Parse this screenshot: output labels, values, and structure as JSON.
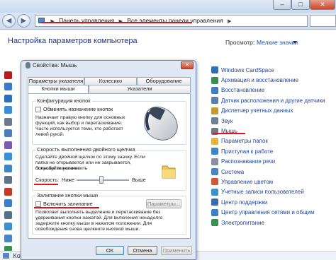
{
  "window": {
    "buttons": {
      "minimize": "–",
      "maximize": "□",
      "close": "✕"
    }
  },
  "address": {
    "back_icon": "back-arrow-icon",
    "forward_icon": "forward-arrow-icon",
    "root_icon": "control-panel-icon",
    "segments": [
      "Панель управления",
      "Все элементы панели управления"
    ]
  },
  "page": {
    "title": "Настройка параметров компьютера",
    "view_label": "Просмотр:",
    "view_value": "Мелкие значки"
  },
  "left_items": [
    {
      "icon": "flash-icon",
      "color": "#b71c1c"
    },
    {
      "icon": "windows-flag-icon",
      "color": "#3a78c9"
    },
    {
      "icon": "notification-icon",
      "color": "#2f6fb6"
    },
    {
      "icon": "toolbar-icon",
      "color": "#3c8bd6"
    },
    {
      "icon": "mouse-icon",
      "color": "#6b7b8c"
    },
    {
      "icon": "program-icon",
      "color": "#4a7fbf"
    },
    {
      "icon": "defender-icon",
      "color": "#7a5bb0"
    },
    {
      "icon": "book-icon",
      "color": "#3f8fd6"
    },
    {
      "icon": "clock-icon",
      "color": "#3a86c7"
    },
    {
      "icon": "keyboard-icon",
      "color": "#5e738a"
    },
    {
      "icon": "shield-icon",
      "color": "#c5392d"
    },
    {
      "icon": "network-icon",
      "color": "#3f7ec4"
    },
    {
      "icon": "printer-icon",
      "color": "#58708a"
    },
    {
      "icon": "user-icon",
      "color": "#3a91d0"
    },
    {
      "icon": "monitor-icon",
      "color": "#4a84c2"
    },
    {
      "icon": "globe-icon",
      "color": "#3a8e52"
    }
  ],
  "right_items": [
    {
      "label": "Windows CardSpace",
      "icon": "cardspace-icon",
      "color": "#2f6fb6"
    },
    {
      "label": "Архивация и восстановление",
      "icon": "backup-icon",
      "color": "#3a8e52"
    },
    {
      "label": "Восстановление",
      "icon": "recovery-icon",
      "color": "#3f7ec4"
    },
    {
      "label": "Датчик расположения и другие датчики",
      "icon": "sensor-icon",
      "color": "#5a7fa8"
    },
    {
      "label": "Диспетчер учетных данных",
      "icon": "credential-icon",
      "color": "#c89a2c"
    },
    {
      "label": "Звук",
      "icon": "speaker-icon",
      "color": "#6e7f92"
    },
    {
      "label": "Мышь",
      "icon": "mouse-icon",
      "color": "#6b7b8c"
    },
    {
      "label": "Параметры папок",
      "icon": "folder-icon",
      "color": "#e3b43c"
    },
    {
      "label": "Приступая к работе",
      "icon": "start-icon",
      "color": "#3a86c7"
    },
    {
      "label": "Распознавание речи",
      "icon": "microphone-icon",
      "color": "#8b8f97"
    },
    {
      "label": "Система",
      "icon": "computer-icon",
      "color": "#4a84c2"
    },
    {
      "label": "Управление цветом",
      "icon": "color-icon",
      "color": "#d0583a"
    },
    {
      "label": "Учетные записи пользователей",
      "icon": "users-icon",
      "color": "#3a91d0"
    },
    {
      "label": "Центр поддержки",
      "icon": "flag-icon",
      "color": "#3b68b5"
    },
    {
      "label": "Центр управления сетями и общим",
      "icon": "network-icon",
      "color": "#3f7ec4"
    },
    {
      "label": "Электропитание",
      "icon": "power-icon",
      "color": "#3a8e52"
    }
  ],
  "status": {
    "text": "Ко"
  },
  "dialog": {
    "title": "Свойства: Мышь",
    "close": "✕",
    "tabs_back": [
      "Параметры указателя",
      "Колесико",
      "Оборудование"
    ],
    "tabs_front": [
      "Кнопки мыши",
      "Указатели"
    ],
    "buttons_group": {
      "label": "Конфигурация кнопок",
      "checkbox": "Обменять назначение кнопок",
      "lines": [
        "Назначает правую кнопку для основных функций, как выбор и перетаскивание. Часто используется теми, кто работает",
        "левой рукой."
      ]
    },
    "speed_group": {
      "label": "Скорость выполнения двойного щелчка",
      "lines": [
        "Сделайте двойной щелчок по этому значку. Если папка не открывается или не закрывается, попробуйте установить",
        "большее значение."
      ],
      "speed_label": "Скорость:",
      "low": "Ниже",
      "high": "Выше",
      "slider_fraction": 0.47
    },
    "clicklock_group": {
      "label": "Залипание кнопки мыши",
      "checkbox": "Включить залипание",
      "params_button": "Параметры...",
      "lines": [
        "Позволяет выполнять выделение и перетаскивание без удерживания кнопки нажатой. Для включения ненадолго",
        "задержите кнопку мыши в нажатом положении. Для освобождения снова щелкните кнопкой мыши."
      ]
    },
    "ok": "ОК",
    "cancel": "Отмена",
    "apply": "Применить"
  }
}
